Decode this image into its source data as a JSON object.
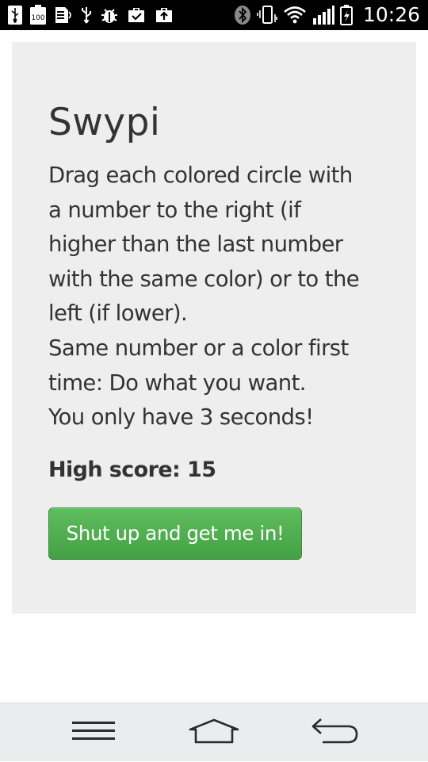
{
  "status_bar": {
    "time": "10:26",
    "battery_level_label": "100",
    "icons_left": [
      "usb-icon",
      "battery-100-icon",
      "sd-card-icon",
      "usb-icon",
      "bug-icon",
      "briefcase-check-icon",
      "briefcase-up-icon"
    ],
    "icons_right": [
      "bluetooth-icon",
      "vibrate-icon",
      "wifi-icon",
      "signal-icon",
      "battery-charging-icon"
    ]
  },
  "app": {
    "title": "Swypi",
    "instructions": [
      "Drag each colored circle with",
      "a number to the right (if",
      "higher than the last number",
      "with the same color) or to the",
      "left (if lower).",
      "Same number or a color first",
      "time: Do what you want.",
      "You only have 3 seconds!"
    ],
    "high_score_label": "High score: 15",
    "high_score": 15,
    "start_button_label": "Shut up and get me in!"
  },
  "nav_bar": {
    "buttons": [
      "menu-icon",
      "home-icon",
      "back-icon"
    ]
  },
  "colors": {
    "card_background": "#eeeeee",
    "text": "#333333",
    "button_green": "#4cae4c",
    "status_bar": "#000000",
    "nav_bar": "#eaecee"
  }
}
